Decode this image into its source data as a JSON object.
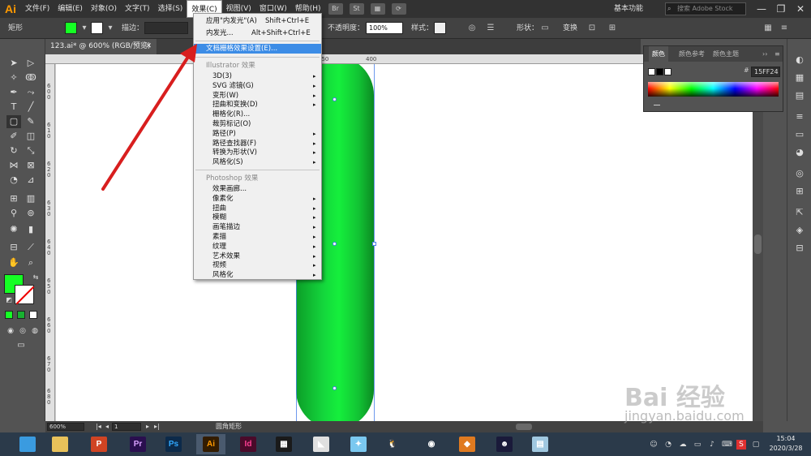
{
  "menubar": {
    "logo": "Ai",
    "items": [
      "文件(F)",
      "编辑(E)",
      "对象(O)",
      "文字(T)",
      "选择(S)",
      "效果(C)",
      "视图(V)",
      "窗口(W)",
      "帮助(H)"
    ],
    "icons": [
      "Br",
      "St"
    ],
    "workspace": "基本功能",
    "search_placeholder": "搜索 Adobe Stock",
    "window_controls": [
      "—",
      "❐",
      "✕"
    ]
  },
  "controlbar": {
    "shape_label": "矩形",
    "stroke_label": "描边：",
    "opacity_label": "不透明度：",
    "opacity_value": "100%",
    "style_label": "样式：",
    "shape_prop_label": "形状：",
    "transform_label": "变换",
    "fill_color": "#15ff24"
  },
  "document": {
    "tab_title": "123.ai* @ 600% (RGB/预览)",
    "tab_close": "✕"
  },
  "ruler": {
    "top_labels": [
      "350",
      "400"
    ],
    "left_labels": [
      "6 0 0",
      "6 1 0",
      "6 2 0",
      "6 3 0",
      "6 4 0",
      "6 5 0",
      "6 6 0",
      "6 7 0",
      "6 8 0"
    ]
  },
  "dropdown": {
    "top_items": [
      {
        "label": "应用\"内发光\"(A)",
        "shortcut": "Shift+Ctrl+E"
      },
      {
        "label": "内发光...",
        "shortcut": "Alt+Shift+Ctrl+E"
      }
    ],
    "highlight_item": "文档栅格效果设置(E)...",
    "illustrator_header": "Illustrator 效果",
    "illustrator_items": [
      "3D(3)",
      "SVG 滤镜(G)",
      "变形(W)",
      "扭曲和变换(D)",
      "栅格化(R)...",
      "裁剪标记(O)",
      "路径(P)",
      "路径查找器(F)",
      "转换为形状(V)",
      "风格化(S)"
    ],
    "illustrator_has_sub": [
      true,
      true,
      true,
      true,
      false,
      false,
      true,
      true,
      true,
      true
    ],
    "photoshop_header": "Photoshop 效果",
    "photoshop_items": [
      "效果画廊...",
      "像素化",
      "扭曲",
      "模糊",
      "画笔描边",
      "素描",
      "纹理",
      "艺术效果",
      "视频",
      "风格化"
    ],
    "photoshop_has_sub": [
      false,
      true,
      true,
      true,
      true,
      true,
      true,
      true,
      true,
      true
    ],
    "submenu_arrow": "▸"
  },
  "color_panel": {
    "tabs": [
      "颜色",
      "颜色参考",
      "颜色主题"
    ],
    "hex_value": "15FF24",
    "hash": "#",
    "more": "››",
    "menu": "≡"
  },
  "statusbar": {
    "zoom": "600%",
    "page": "1",
    "tool_label": "圆角矩形"
  },
  "taskbar": {
    "apps": [
      {
        "name": "windows-browser",
        "label": "",
        "color": "#3a9be0"
      },
      {
        "name": "file-explorer",
        "label": "",
        "color": "#e8c15a"
      },
      {
        "name": "powerpoint",
        "label": "P",
        "color": "#d04423"
      },
      {
        "name": "premiere",
        "label": "Pr",
        "color": "#2a0f4f"
      },
      {
        "name": "photoshop",
        "label": "Ps",
        "color": "#0c2a4a"
      },
      {
        "name": "illustrator",
        "label": "Ai",
        "color": "#331c00"
      },
      {
        "name": "indesign",
        "label": "Id",
        "color": "#4a0a2a"
      },
      {
        "name": "video-editor",
        "label": "▦",
        "color": "#1a1a1a"
      },
      {
        "name": "media-app",
        "label": "◣",
        "color": "#e0e0e0"
      },
      {
        "name": "chat-app",
        "label": "✦",
        "color": "#7ac8f0"
      },
      {
        "name": "qq",
        "label": "🐧",
        "color": "#2b3a4a"
      },
      {
        "name": "chrome",
        "label": "◉",
        "color": "#2b3a4a"
      },
      {
        "name": "fox-app",
        "label": "◆",
        "color": "#e07a20"
      },
      {
        "name": "avatar-app",
        "label": "☻",
        "color": "#1a1a3a"
      },
      {
        "name": "notes-app",
        "label": "▤",
        "color": "#a0c8e0"
      }
    ],
    "time": "15:04",
    "date": "2020/3/28"
  },
  "watermark": {
    "brand": "Bai 经验",
    "url": "jingyan.baidu.com"
  }
}
